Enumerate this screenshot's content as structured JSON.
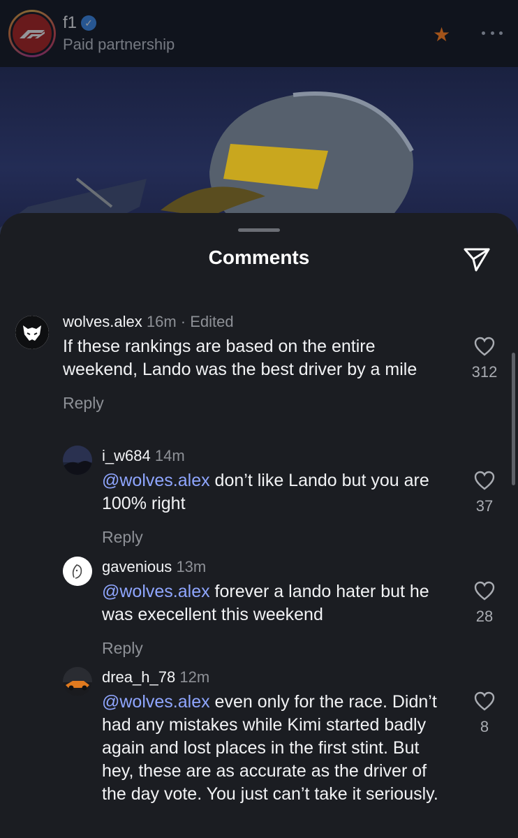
{
  "post": {
    "account": "f1",
    "subtitle": "Paid partnership"
  },
  "sheet": {
    "title": "Comments"
  },
  "comments": [
    {
      "user": "wolves.alex",
      "meta": "16m · Edited",
      "mention": "",
      "text": "If these rankings are based on the entire weekend, Lando was the best driver by a mile",
      "reply_label": "Reply",
      "likes": "312"
    },
    {
      "user": "i_w684",
      "meta": "14m",
      "mention": "@wolves.alex",
      "text": " don’t like Lando but you are 100% right",
      "reply_label": "Reply",
      "likes": "37"
    },
    {
      "user": "gavenious",
      "meta": "13m",
      "mention": "@wolves.alex",
      "text": " forever a lando hater but he was execellent this weekend",
      "reply_label": "Reply",
      "likes": "28"
    },
    {
      "user": "drea_h_78",
      "meta": "12m",
      "mention": "@wolves.alex",
      "text": " even only for the race. Didn’t had any mistakes while Kimi started badly again and lost places in the first stint. But hey, these are as accurate as the driver of the day vote. You just can’t take it seriously.",
      "reply_label": "",
      "likes": "8"
    }
  ],
  "colors": {
    "mention": "#8fa6ff",
    "sheet_bg": "#1b1d22",
    "verified": "#3a8cf0",
    "star": "#d46a1a"
  },
  "icons": {
    "share": "send-icon",
    "like": "heart-icon",
    "more": "more-icon",
    "star": "star-icon"
  }
}
